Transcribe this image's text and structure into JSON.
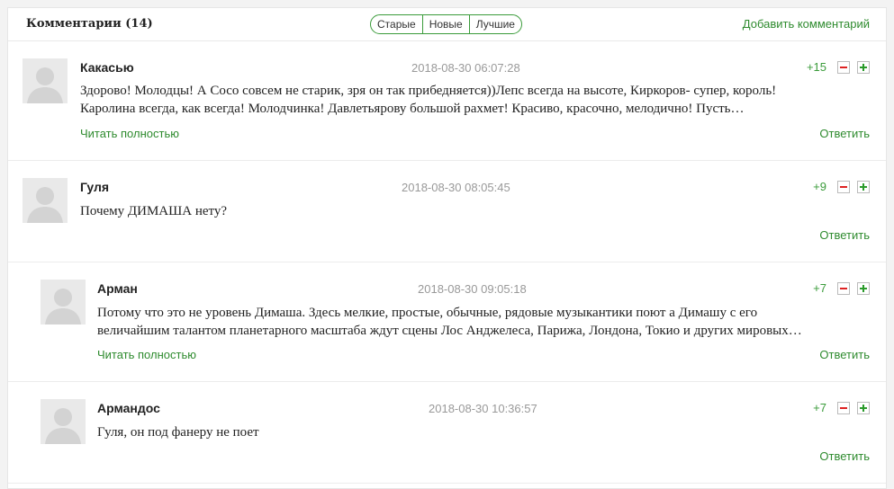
{
  "header": {
    "title": "Комментарии (14)",
    "sort_tabs": [
      "Старые",
      "Новые",
      "Лучшие"
    ],
    "add_comment": "Добавить комментарий"
  },
  "comments": [
    {
      "author": "Какасью",
      "date": "2018-08-30 06:07:28",
      "score": "+15",
      "text_lines": [
        "Здорово! Молодцы! А Сосо совсем не старик, зря он так прибедняется))Лепс всегда на высоте, Киркоров- супер, король!",
        "Каролина всегда, как всегда! Молодчинка! Давлетьярову большой рахмет! Красиво, красочно, мелодично! Пусть…"
      ],
      "read_more": "Читать полностью",
      "reply": "Ответить"
    },
    {
      "author": "Гуля",
      "date": "2018-08-30 08:05:45",
      "score": "+9",
      "text_lines": [
        "Почему ДИМАША нету?"
      ],
      "reply": "Ответить"
    },
    {
      "author": "Арман",
      "date": "2018-08-30 09:05:18",
      "score": "+7",
      "text_lines": [
        "Потому что это не уровень Димаша. Здесь мелкие, простые, обычные, рядовые музыкантики поют а Димашу с его",
        "величайшим талантом планетарного масштаба ждут сцены Лос Анджелеса, Парижа, Лондона, Токио и других мировых…"
      ],
      "read_more": "Читать полностью",
      "reply": "Ответить"
    },
    {
      "author": "Армандос",
      "date": "2018-08-30 10:36:57",
      "score": "+7",
      "text_lines": [
        "Гуля, он под фанеру не поет"
      ],
      "reply": "Ответить"
    }
  ],
  "icons": {
    "avatar": "user-silhouette-icon",
    "minus": "minus-icon",
    "plus": "plus-icon"
  },
  "colors": {
    "accent": "#2e8b2e",
    "minus": "#dd2222",
    "date": "#999999"
  }
}
